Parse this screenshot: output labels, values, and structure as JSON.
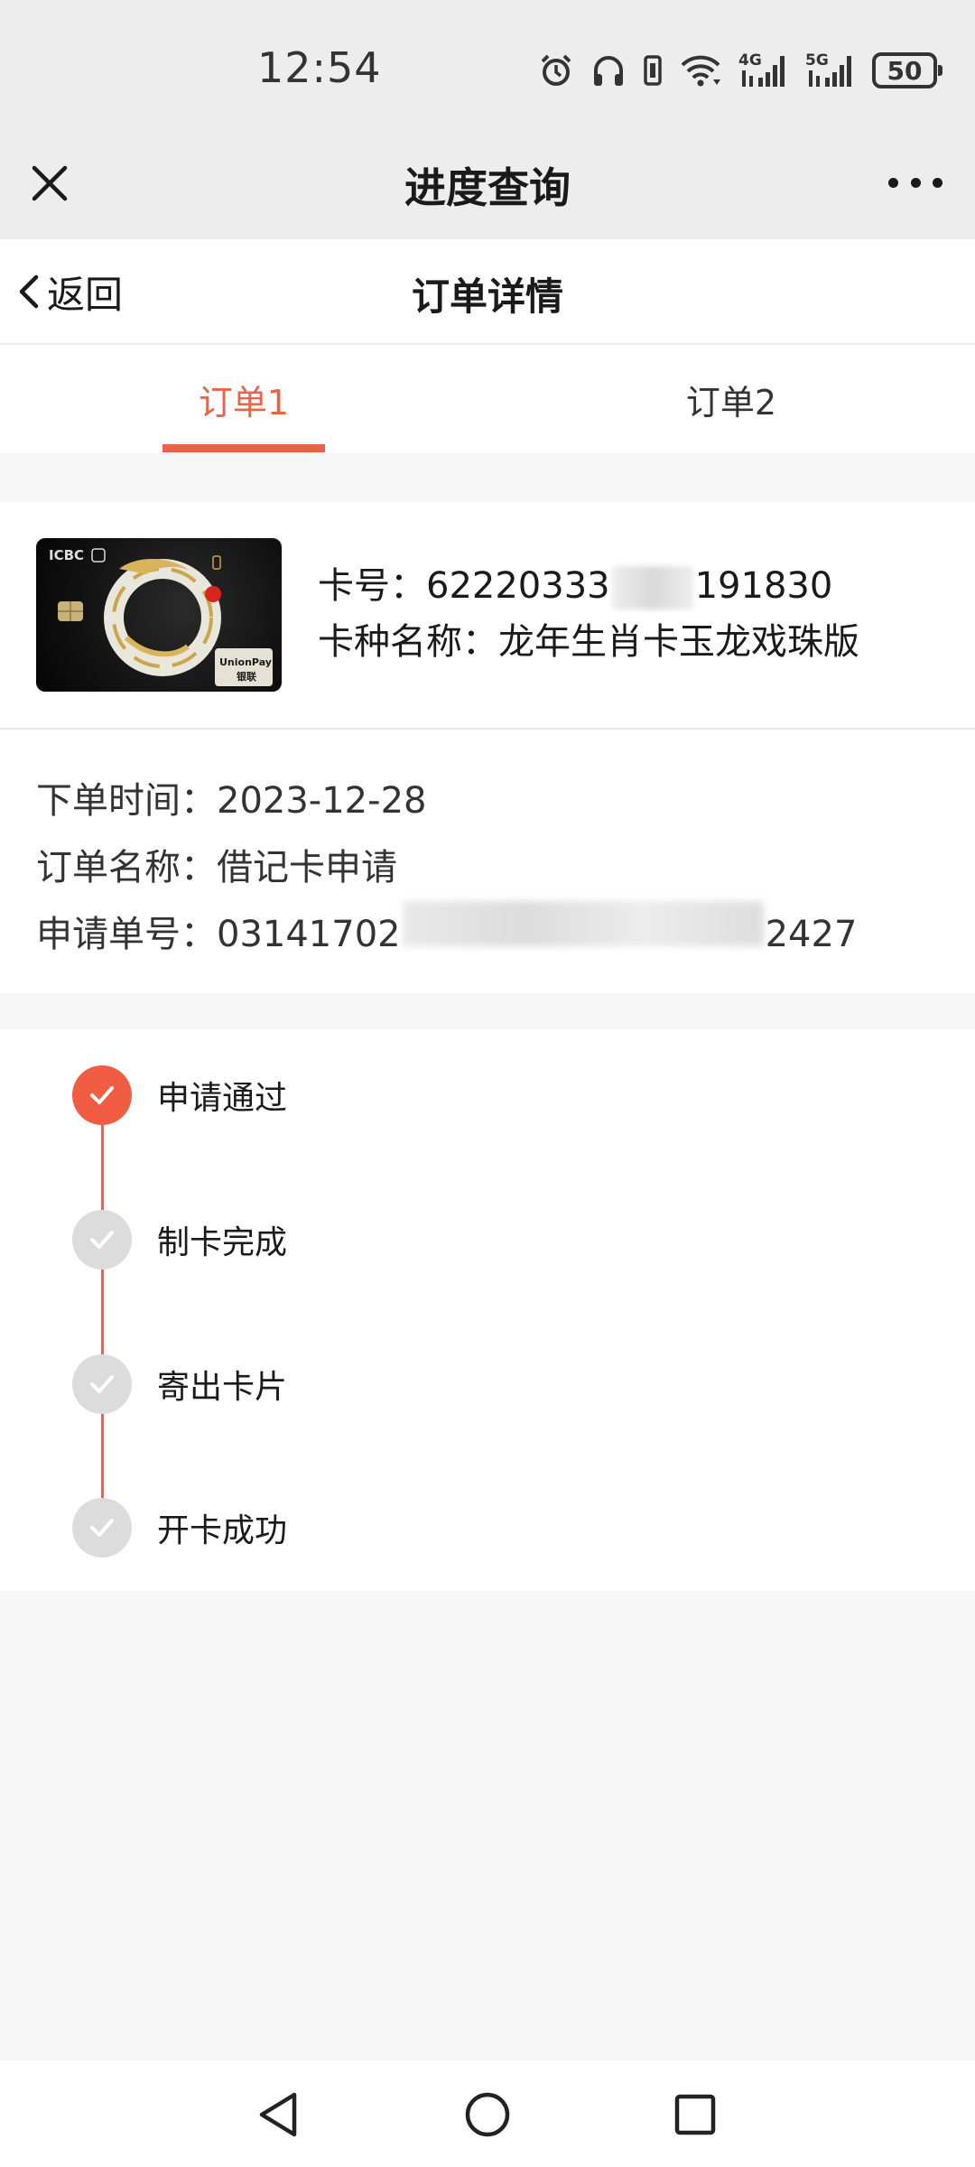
{
  "status_bar": {
    "time": "12:54",
    "icons": [
      "alarm-icon",
      "headphones-icon",
      "vibrate-icon",
      "wifi-icon",
      "signal-4g-icon",
      "signal-5g-icon"
    ],
    "net_4g": "4G",
    "net_5g": "5G",
    "battery": "50"
  },
  "webview": {
    "title": "进度查询",
    "close_icon": "close-icon",
    "more_icon": "more-icon"
  },
  "page": {
    "back_label": "返回",
    "title": "订单详情"
  },
  "tabs": [
    {
      "label": "订单1",
      "active": true
    },
    {
      "label": "订单2",
      "active": false
    }
  ],
  "card": {
    "number_label": "卡号：",
    "number_prefix": "62220333",
    "number_suffix": "191830",
    "type_label": "卡种名称：",
    "type_value": "龙年生肖卡玉龙戏珠版",
    "image_text_bank": "ICBC",
    "image_text_network": "UnionPay",
    "image_text_network_cn": "银联"
  },
  "order": {
    "time_label": "下单时间：",
    "time_value": "2023-12-28",
    "name_label": "订单名称：",
    "name_value": "借记卡申请",
    "id_label": "申请单号：",
    "id_prefix": "03141702",
    "id_suffix": "2427"
  },
  "progress": {
    "steps": [
      {
        "label": "申请通过",
        "done": true
      },
      {
        "label": "制卡完成",
        "done": false
      },
      {
        "label": "寄出卡片",
        "done": false
      },
      {
        "label": "开卡成功",
        "done": false
      }
    ]
  },
  "colors": {
    "accent": "#e8634a",
    "step_done": "#f05d43",
    "step_pending": "#dcdcdc",
    "timeline": "#c47462"
  }
}
